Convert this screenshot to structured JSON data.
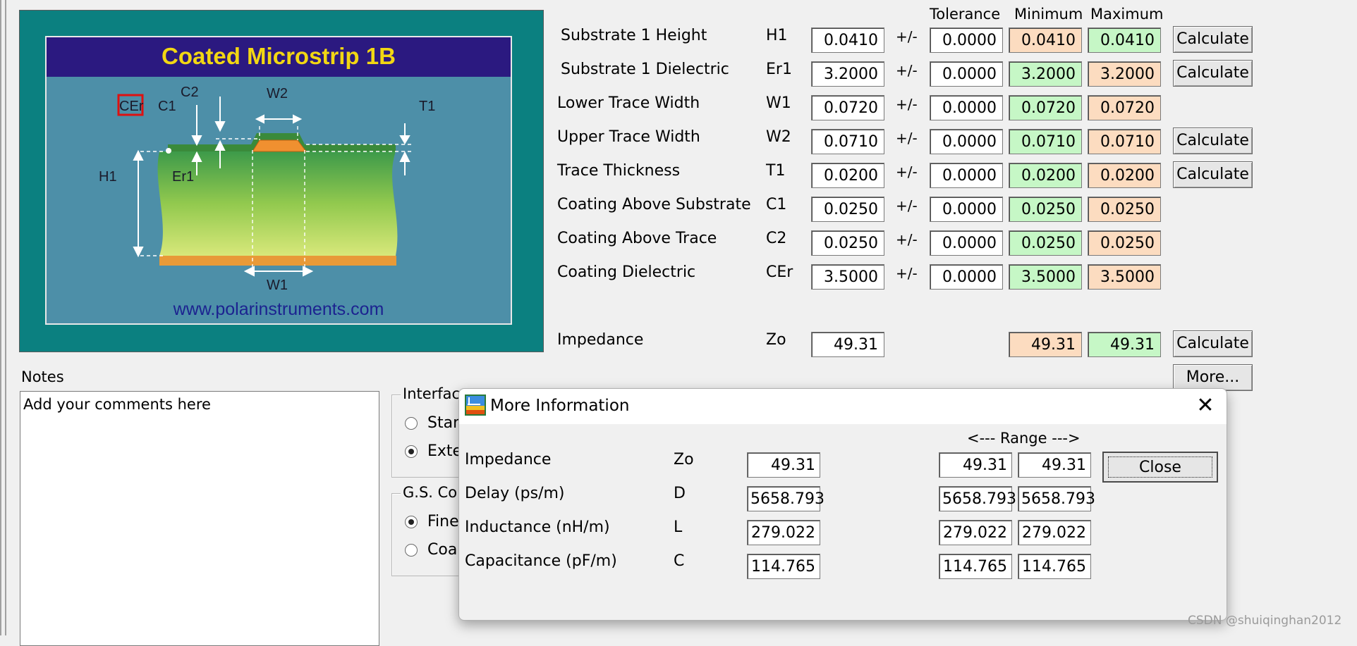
{
  "diagram": {
    "title": "Coated Microstrip 1B",
    "url": "www.polarinstruments.com",
    "labels": {
      "cer": "CEr",
      "c1": "C1",
      "c2": "C2",
      "w2": "W2",
      "t1": "T1",
      "h1": "H1",
      "er1": "Er1",
      "w1": "W1"
    }
  },
  "table": {
    "headers": {
      "tolerance": "Tolerance",
      "minimum": "Minimum",
      "maximum": "Maximum"
    },
    "plus_minus": "+/-",
    "rows": [
      {
        "label": "Substrate 1 Height",
        "symbol": "H1",
        "value": "0.0410",
        "tolerance": "0.0000",
        "min": "0.0410",
        "max": "0.0410",
        "min_color": "peach",
        "max_color": "green",
        "calc": "Calculate"
      },
      {
        "label": "Substrate 1 Dielectric",
        "symbol": "Er1",
        "value": "3.2000",
        "tolerance": "0.0000",
        "min": "3.2000",
        "max": "3.2000",
        "min_color": "green",
        "max_color": "peach",
        "calc": "Calculate"
      },
      {
        "label": "Lower Trace Width",
        "symbol": "W1",
        "value": "0.0720",
        "tolerance": "0.0000",
        "min": "0.0720",
        "max": "0.0720",
        "min_color": "green",
        "max_color": "peach",
        "calc": ""
      },
      {
        "label": "Upper Trace Width",
        "symbol": "W2",
        "value": "0.0710",
        "tolerance": "0.0000",
        "min": "0.0710",
        "max": "0.0710",
        "min_color": "green",
        "max_color": "peach",
        "calc": "Calculate"
      },
      {
        "label": "Trace Thickness",
        "symbol": "T1",
        "value": "0.0200",
        "tolerance": "0.0000",
        "min": "0.0200",
        "max": "0.0200",
        "min_color": "green",
        "max_color": "peach",
        "calc": "Calculate"
      },
      {
        "label": "Coating Above Substrate",
        "symbol": "C1",
        "value": "0.0250",
        "tolerance": "0.0000",
        "min": "0.0250",
        "max": "0.0250",
        "min_color": "green",
        "max_color": "peach",
        "calc": ""
      },
      {
        "label": "Coating Above Trace",
        "symbol": "C2",
        "value": "0.0250",
        "tolerance": "0.0000",
        "min": "0.0250",
        "max": "0.0250",
        "min_color": "green",
        "max_color": "peach",
        "calc": ""
      },
      {
        "label": "Coating Dielectric",
        "symbol": "CEr",
        "value": "3.5000",
        "tolerance": "0.0000",
        "min": "3.5000",
        "max": "3.5000",
        "min_color": "green",
        "max_color": "peach",
        "calc": ""
      }
    ],
    "impedance": {
      "label": "Impedance",
      "symbol": "Zo",
      "value": "49.31",
      "min": "49.31",
      "max": "49.31",
      "min_color": "peach",
      "max_color": "green",
      "calc": "Calculate"
    },
    "more_button": "More...",
    "colors": {
      "green": "#c6f7c6",
      "peach": "#fcdcc0"
    }
  },
  "notes": {
    "label": "Notes",
    "text": "Add your comments here"
  },
  "interface_group": {
    "label": "Interface",
    "options": [
      {
        "label": "Stan",
        "selected": false
      },
      {
        "label": "Exte",
        "selected": true
      }
    ]
  },
  "gs_group": {
    "label": "G.S. Co",
    "options": [
      {
        "label": "Fine",
        "selected": true
      },
      {
        "label": "Coar",
        "selected": false
      }
    ]
  },
  "dialog": {
    "title": "More Information",
    "close_glyph": "✕",
    "range_label": "<--- Range --->",
    "rows": [
      {
        "label": "Impedance",
        "symbol": "Zo",
        "value": "49.31",
        "range_min": "49.31",
        "range_max": "49.31"
      },
      {
        "label": "Delay (ps/m)",
        "symbol": "D",
        "value": "5658.793",
        "range_min": "5658.793",
        "range_max": "5658.793"
      },
      {
        "label": "Inductance (nH/m)",
        "symbol": "L",
        "value": "279.022",
        "range_min": "279.022",
        "range_max": "279.022"
      },
      {
        "label": "Capacitance (pF/m)",
        "symbol": "C",
        "value": "114.765",
        "range_min": "114.765",
        "range_max": "114.765"
      }
    ],
    "close_button": "Close"
  },
  "watermark": "CSDN @shuiqinghan2012"
}
